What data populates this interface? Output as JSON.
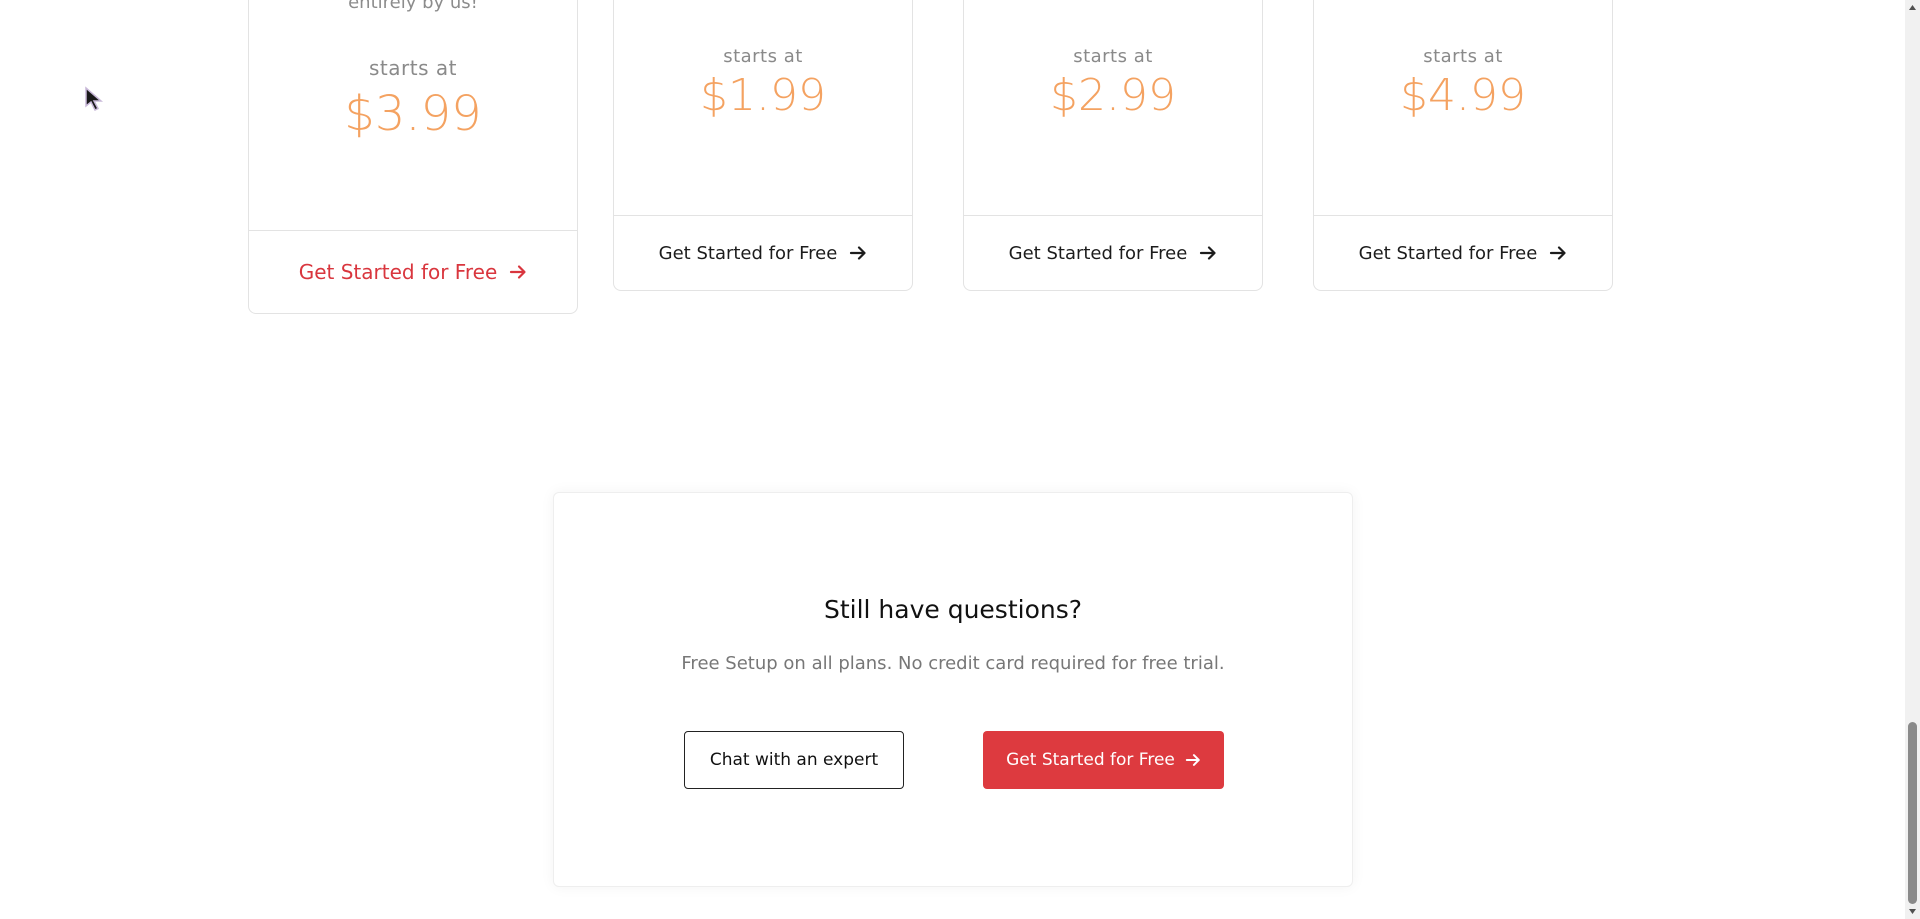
{
  "pricing_cards": [
    {
      "cutoff_text": "entirely by us!",
      "starts_label": "starts at",
      "price": "$3.99",
      "cta": "Get Started for Free",
      "featured": true
    },
    {
      "cutoff_text": "",
      "starts_label": "starts at",
      "price": "$1.99",
      "cta": "Get Started for Free",
      "featured": false
    },
    {
      "cutoff_text": "",
      "starts_label": "starts at",
      "price": "$2.99",
      "cta": "Get Started for Free",
      "featured": false
    },
    {
      "cutoff_text": "",
      "starts_label": "starts at",
      "price": "$4.99",
      "cta": "Get Started for Free",
      "featured": false
    }
  ],
  "questions": {
    "title": "Still have questions?",
    "subtitle": "Free Setup on all plans. No credit card required for free trial.",
    "chat_button": "Chat with an expert",
    "start_button": "Get Started for Free"
  },
  "colors": {
    "accent_red": "#dd3a3f",
    "price_orange": "#f4a261"
  },
  "icons": {
    "cta_arrow": "arrow-right-icon",
    "cursor": "mouse-cursor-icon"
  }
}
